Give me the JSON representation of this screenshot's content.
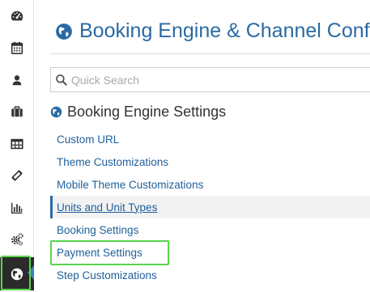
{
  "sidebar": {
    "items": [
      {
        "icon": "dashboard-icon"
      },
      {
        "icon": "calendar-icon"
      },
      {
        "icon": "user-icon"
      },
      {
        "icon": "briefcase-icon"
      },
      {
        "icon": "table-icon"
      },
      {
        "icon": "ticket-icon"
      },
      {
        "icon": "bar-chart-icon"
      },
      {
        "icon": "cogs-icon"
      },
      {
        "icon": "globe-icon",
        "active": true
      }
    ]
  },
  "header": {
    "title": "Booking Engine & Channel Config"
  },
  "search": {
    "placeholder": "Quick Search"
  },
  "section": {
    "title": "Booking Engine Settings",
    "items": [
      {
        "label": "Custom URL"
      },
      {
        "label": "Theme Customizations"
      },
      {
        "label": "Mobile Theme Customizations"
      },
      {
        "label": "Units and Unit Types",
        "selected": true
      },
      {
        "label": "Booking Settings"
      },
      {
        "label": "Payment Settings",
        "highlighted": true
      },
      {
        "label": "Step Customizations"
      }
    ]
  },
  "colors": {
    "accent": "#2a6aa4",
    "link": "#1e5f9a",
    "highlight": "#58d64a",
    "sidebar_active": "#2b2b2b"
  }
}
